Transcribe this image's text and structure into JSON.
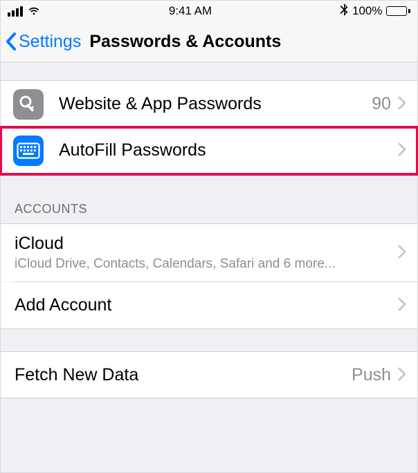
{
  "status": {
    "time": "9:41 AM",
    "battery_pct": "100%"
  },
  "nav": {
    "back_label": "Settings",
    "title": "Passwords & Accounts"
  },
  "passwords_group": {
    "website_app_label": "Website & App Passwords",
    "website_app_count": "90",
    "autofill_label": "AutoFill Passwords"
  },
  "accounts_group": {
    "header": "ACCOUNTS",
    "icloud_label": "iCloud",
    "icloud_detail": "iCloud Drive, Contacts, Calendars, Safari  and 6 more...",
    "add_account_label": "Add Account"
  },
  "fetch_group": {
    "fetch_label": "Fetch New Data",
    "fetch_value": "Push"
  }
}
